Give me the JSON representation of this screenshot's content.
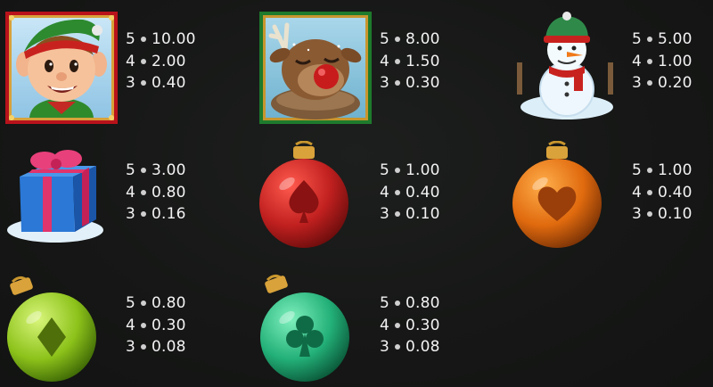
{
  "symbols": [
    {
      "name": "elf",
      "pays": [
        {
          "count": "5",
          "value": "10.00"
        },
        {
          "count": "4",
          "value": "2.00"
        },
        {
          "count": "3",
          "value": "0.40"
        }
      ]
    },
    {
      "name": "reindeer",
      "pays": [
        {
          "count": "5",
          "value": "8.00"
        },
        {
          "count": "4",
          "value": "1.50"
        },
        {
          "count": "3",
          "value": "0.30"
        }
      ]
    },
    {
      "name": "snowman",
      "pays": [
        {
          "count": "5",
          "value": "5.00"
        },
        {
          "count": "4",
          "value": "1.00"
        },
        {
          "count": "3",
          "value": "0.20"
        }
      ]
    },
    {
      "name": "gift-box",
      "pays": [
        {
          "count": "5",
          "value": "3.00"
        },
        {
          "count": "4",
          "value": "0.80"
        },
        {
          "count": "3",
          "value": "0.16"
        }
      ]
    },
    {
      "name": "red-spade-ornament",
      "color": "#c0201f",
      "suit": "spade",
      "pays": [
        {
          "count": "5",
          "value": "1.00"
        },
        {
          "count": "4",
          "value": "0.40"
        },
        {
          "count": "3",
          "value": "0.10"
        }
      ]
    },
    {
      "name": "orange-heart-ornament",
      "color": "#e06a0e",
      "suit": "heart",
      "pays": [
        {
          "count": "5",
          "value": "1.00"
        },
        {
          "count": "4",
          "value": "0.40"
        },
        {
          "count": "3",
          "value": "0.10"
        }
      ]
    },
    {
      "name": "green-diamond-ornament",
      "color": "#8cc21a",
      "suit": "diamond",
      "pays": [
        {
          "count": "5",
          "value": "0.80"
        },
        {
          "count": "4",
          "value": "0.30"
        },
        {
          "count": "3",
          "value": "0.08"
        }
      ]
    },
    {
      "name": "teal-club-ornament",
      "color": "#23b078",
      "suit": "club",
      "pays": [
        {
          "count": "5",
          "value": "0.80"
        },
        {
          "count": "4",
          "value": "0.30"
        },
        {
          "count": "3",
          "value": "0.08"
        }
      ]
    }
  ]
}
